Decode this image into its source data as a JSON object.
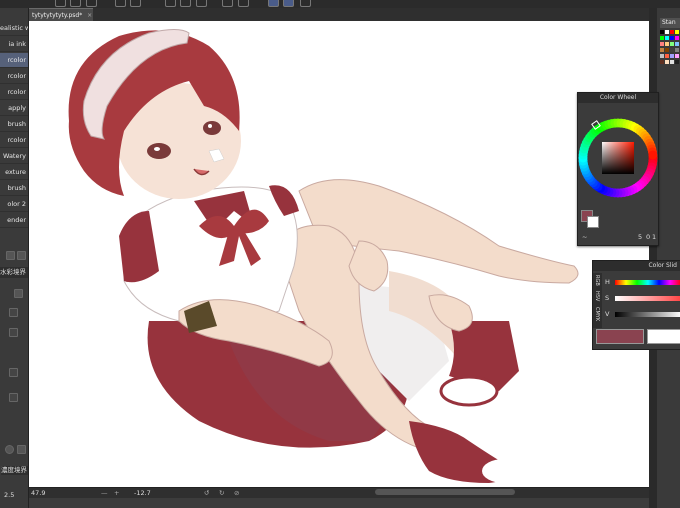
{
  "toolbar": {
    "icons": [
      "new-icon",
      "open-icon",
      "save-icon",
      "undo-icon",
      "redo-icon",
      "transform-icon",
      "brush-icon",
      "lasso-icon",
      "fill-icon",
      "ruler-icon",
      "snap-icon",
      "snap2-icon",
      "special-ruler-icon"
    ]
  },
  "document_tab": {
    "label": "tytytytytyty.psd*",
    "close": "×"
  },
  "sub_tools": [
    {
      "label": "ealistic w",
      "selected": false
    },
    {
      "label": "ia ink",
      "selected": false
    },
    {
      "label": "rcolor",
      "selected": true
    },
    {
      "label": "rcolor",
      "selected": false
    },
    {
      "label": "rcolor",
      "selected": false
    },
    {
      "label": "apply",
      "selected": false
    },
    {
      "label": "brush",
      "selected": false
    },
    {
      "label": "rcolor",
      "selected": false
    },
    {
      "label": "Watery",
      "selected": false
    },
    {
      "label": "exture",
      "selected": false
    },
    {
      "label": "brush",
      "selected": false
    },
    {
      "label": "olor 2",
      "selected": false
    },
    {
      "label": "ender",
      "selected": false
    }
  ],
  "tool_property": {
    "header": "水彩境界",
    "brush_size_label": "2.5",
    "density_label": "濃度境界"
  },
  "status_bar": {
    "zoom": "47.9",
    "angle": "-12.7"
  },
  "color_wheel": {
    "title": "Color Wheel",
    "hue_color": "#ff1a00",
    "main_color": "#8a4350",
    "sub_color": "#ffffff",
    "value_a": "5",
    "value_b": "0",
    "value_c": "1"
  },
  "color_slider": {
    "title": "Color Slid",
    "h_label": "H",
    "s_label": "S",
    "v_label": "V",
    "mode_tabs": [
      "RGB",
      "HSV",
      "CMYK"
    ],
    "main_color": "#8a4350",
    "sub_color": "#ffffff"
  },
  "right_panel": {
    "tab_label": "Stan"
  },
  "palette_colors": [
    "#000000",
    "#ffffff",
    "#ff0000",
    "#ffff00",
    "#00ff00",
    "#00ffff",
    "#0000ff",
    "#ff00ff",
    "#ff8080",
    "#ffcc80",
    "#80ff80",
    "#80c0ff",
    "#c08040",
    "#804000",
    "#404040",
    "#808080",
    "#c0c0c0",
    "#ff6040",
    "#a0a0ff",
    "#ffa0ff",
    "#603020",
    "#ffe0c0",
    "#e0e0e0",
    "#202020"
  ],
  "colors": {
    "hair": "#a83a3f",
    "outfit_red": "#97333d",
    "skin": "#f3dccb",
    "shirt": "#ffffff",
    "band": "#f0e0e0"
  }
}
